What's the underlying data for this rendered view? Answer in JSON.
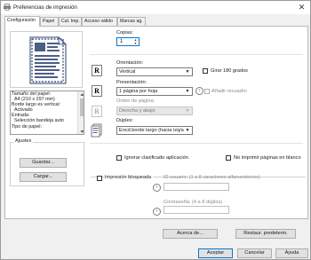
{
  "window": {
    "title": "Preferencias de impresión",
    "close_glyph": "✕",
    "app_icon": "printer-icon"
  },
  "tabs": [
    {
      "label": "Configuración",
      "active": true
    },
    {
      "label": "Papel"
    },
    {
      "label": "Cal. Imp."
    },
    {
      "label": "Acceso válido"
    },
    {
      "label": "Marcas ag."
    }
  ],
  "info_list": {
    "lines": [
      {
        "text": "Tamaño del papel:",
        "indent": false
      },
      {
        "text": "A4 (210 x 297 mm)",
        "indent": true
      },
      {
        "text": "Borde largo es vertical:",
        "indent": false
      },
      {
        "text": "Activado",
        "indent": true
      },
      {
        "text": "Entrada:",
        "indent": false
      },
      {
        "text": "Selección bandeja auto",
        "indent": true
      },
      {
        "text": "Tipo de papel:",
        "indent": false
      }
    ]
  },
  "ajustes": {
    "label": "Ajustes",
    "save": "Guardar...",
    "load": "Cargar..."
  },
  "copies": {
    "label": "Copias:",
    "value": "1"
  },
  "orientation": {
    "label": "Orientación:",
    "value": "Vertical",
    "rotate_label": "Girar 180 grados",
    "rotate_checked": false
  },
  "layout": {
    "label": "Presentación:",
    "value": "1 página por hoja",
    "border_label": "Añadir recuadro",
    "border_checked": false
  },
  "page_order": {
    "label": "Orden de página:",
    "value": "Derecha y abajo"
  },
  "duplex": {
    "label": "Dúplex:",
    "value": "Encd.borde largo (hacia izq/ar"
  },
  "ignore_collate": {
    "label": "Ignorar clasificado aplicación",
    "checked": false
  },
  "no_blank": {
    "label": "No imprimir páginas en blanco",
    "checked": false
  },
  "locked": {
    "label": "Impresión bloqueada",
    "checked": false,
    "user_id_label": "ID usuario: (1 a 8 caracteres alfanuméricos)",
    "password_label": "Contraseña: (4 a 8 dígitos)"
  },
  "buttons": {
    "about": "Acerca de...",
    "restore": "Restaur. predeterm.",
    "ok": "Aceptar",
    "cancel": "Cancelar",
    "help": "Ayuda"
  },
  "colors": {
    "accent": "#0078d7",
    "panel": "#ffffff",
    "chrome": "#f0f0f0"
  }
}
